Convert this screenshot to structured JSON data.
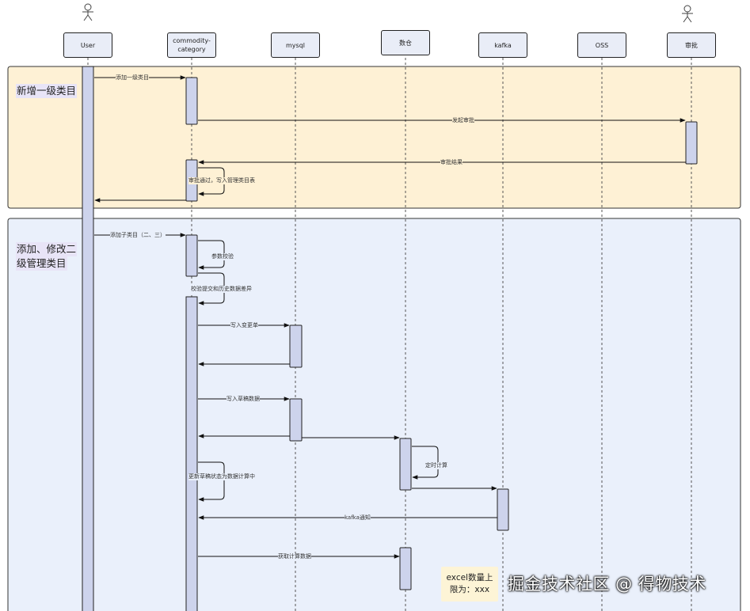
{
  "participants": {
    "user": "User",
    "commodity": "commodity-\ncategory",
    "mysql": "mysql",
    "warehouse": "数仓",
    "kafka": "kafka",
    "oss": "OSS",
    "approval": "审批"
  },
  "groups": {
    "first": "新增一级类目",
    "second_line1": "添加、修改二",
    "second_line2": "级管理类目"
  },
  "messages": {
    "m1": "添加一级类目",
    "m2": "发起审批",
    "m3": "审批结果",
    "m4": "审批通过，写入管理类目表",
    "m5": "添加子类目（二、三）",
    "m6": "参数校验",
    "m7": "校验提交和历史数据差异",
    "m8": "写入变更单",
    "m9": "写入草稿数据",
    "m10": "定时计算",
    "m11": "更新草稿状态为数据计算中",
    "m12": "kafka通知",
    "m13": "获取计算数据"
  },
  "note": {
    "line1": "excel数量上",
    "line2": "限为：xxx"
  },
  "watermark": "掘金技术社区 @ 得物技术",
  "colors": {
    "group1_fill": "#fef1d5",
    "group2_fill": "#eaf0fb",
    "activation": "#cdd3ec",
    "participant_fill": "#e9edf7"
  }
}
